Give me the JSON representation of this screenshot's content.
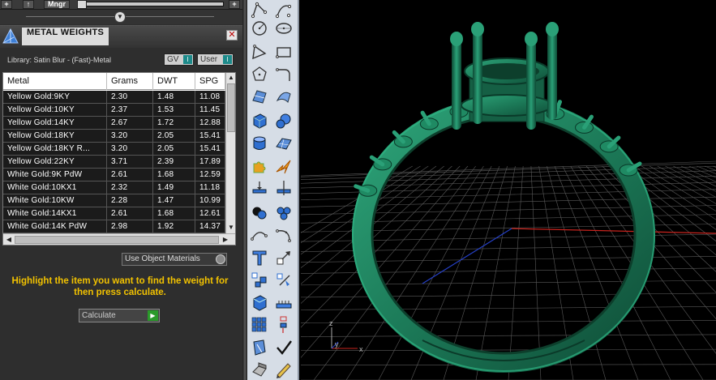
{
  "top_strip": {
    "btn_minus": "+",
    "btn_up": "↑",
    "btn_mngr": "Mngr",
    "btn_plus": "+"
  },
  "panel": {
    "title": "METAL WEIGHTS",
    "close_label": "✕",
    "library_label": "Library: Satin Blur - (Fast)-Metal",
    "gv_label": "GV",
    "user_label": "User",
    "table": {
      "columns": [
        "Metal",
        "Grams",
        "DWT",
        "SPG"
      ],
      "rows": [
        [
          "Yellow Gold:9KY",
          "2.30",
          "1.48",
          "11.08"
        ],
        [
          "Yellow Gold:10KY",
          "2.37",
          "1.53",
          "11.45"
        ],
        [
          "Yellow Gold:14KY",
          "2.67",
          "1.72",
          "12.88"
        ],
        [
          "Yellow Gold:18KY",
          "3.20",
          "2.05",
          "15.41"
        ],
        [
          "Yellow Gold:18KY R...",
          "3.20",
          "2.05",
          "15.41"
        ],
        [
          "Yellow Gold:22KY",
          "3.71",
          "2.39",
          "17.89"
        ],
        [
          "White Gold:9K PdW",
          "2.61",
          "1.68",
          "12.59"
        ],
        [
          "White Gold:10KX1",
          "2.32",
          "1.49",
          "11.18"
        ],
        [
          "White Gold:10KW",
          "2.28",
          "1.47",
          "10.99"
        ],
        [
          "White Gold:14KX1",
          "2.61",
          "1.68",
          "12.61"
        ],
        [
          "White Gold:14K PdW",
          "2.98",
          "1.92",
          "14.37"
        ]
      ]
    },
    "use_object_materials": "Use Object Materials",
    "instructions": "Highlight the item you want to find the weight for then press calculate.",
    "calculate_label": "Calculate"
  },
  "viewport": {
    "axis_labels": {
      "x": "x",
      "y": "y",
      "z": "z"
    },
    "model_color": "#1f7a5a",
    "grid_color": "#5a5a5a"
  },
  "colors": {
    "highlight_text": "#f2c200",
    "panel_bg": "#2e2e2e",
    "toolbar_bg": "#d6dde6"
  }
}
